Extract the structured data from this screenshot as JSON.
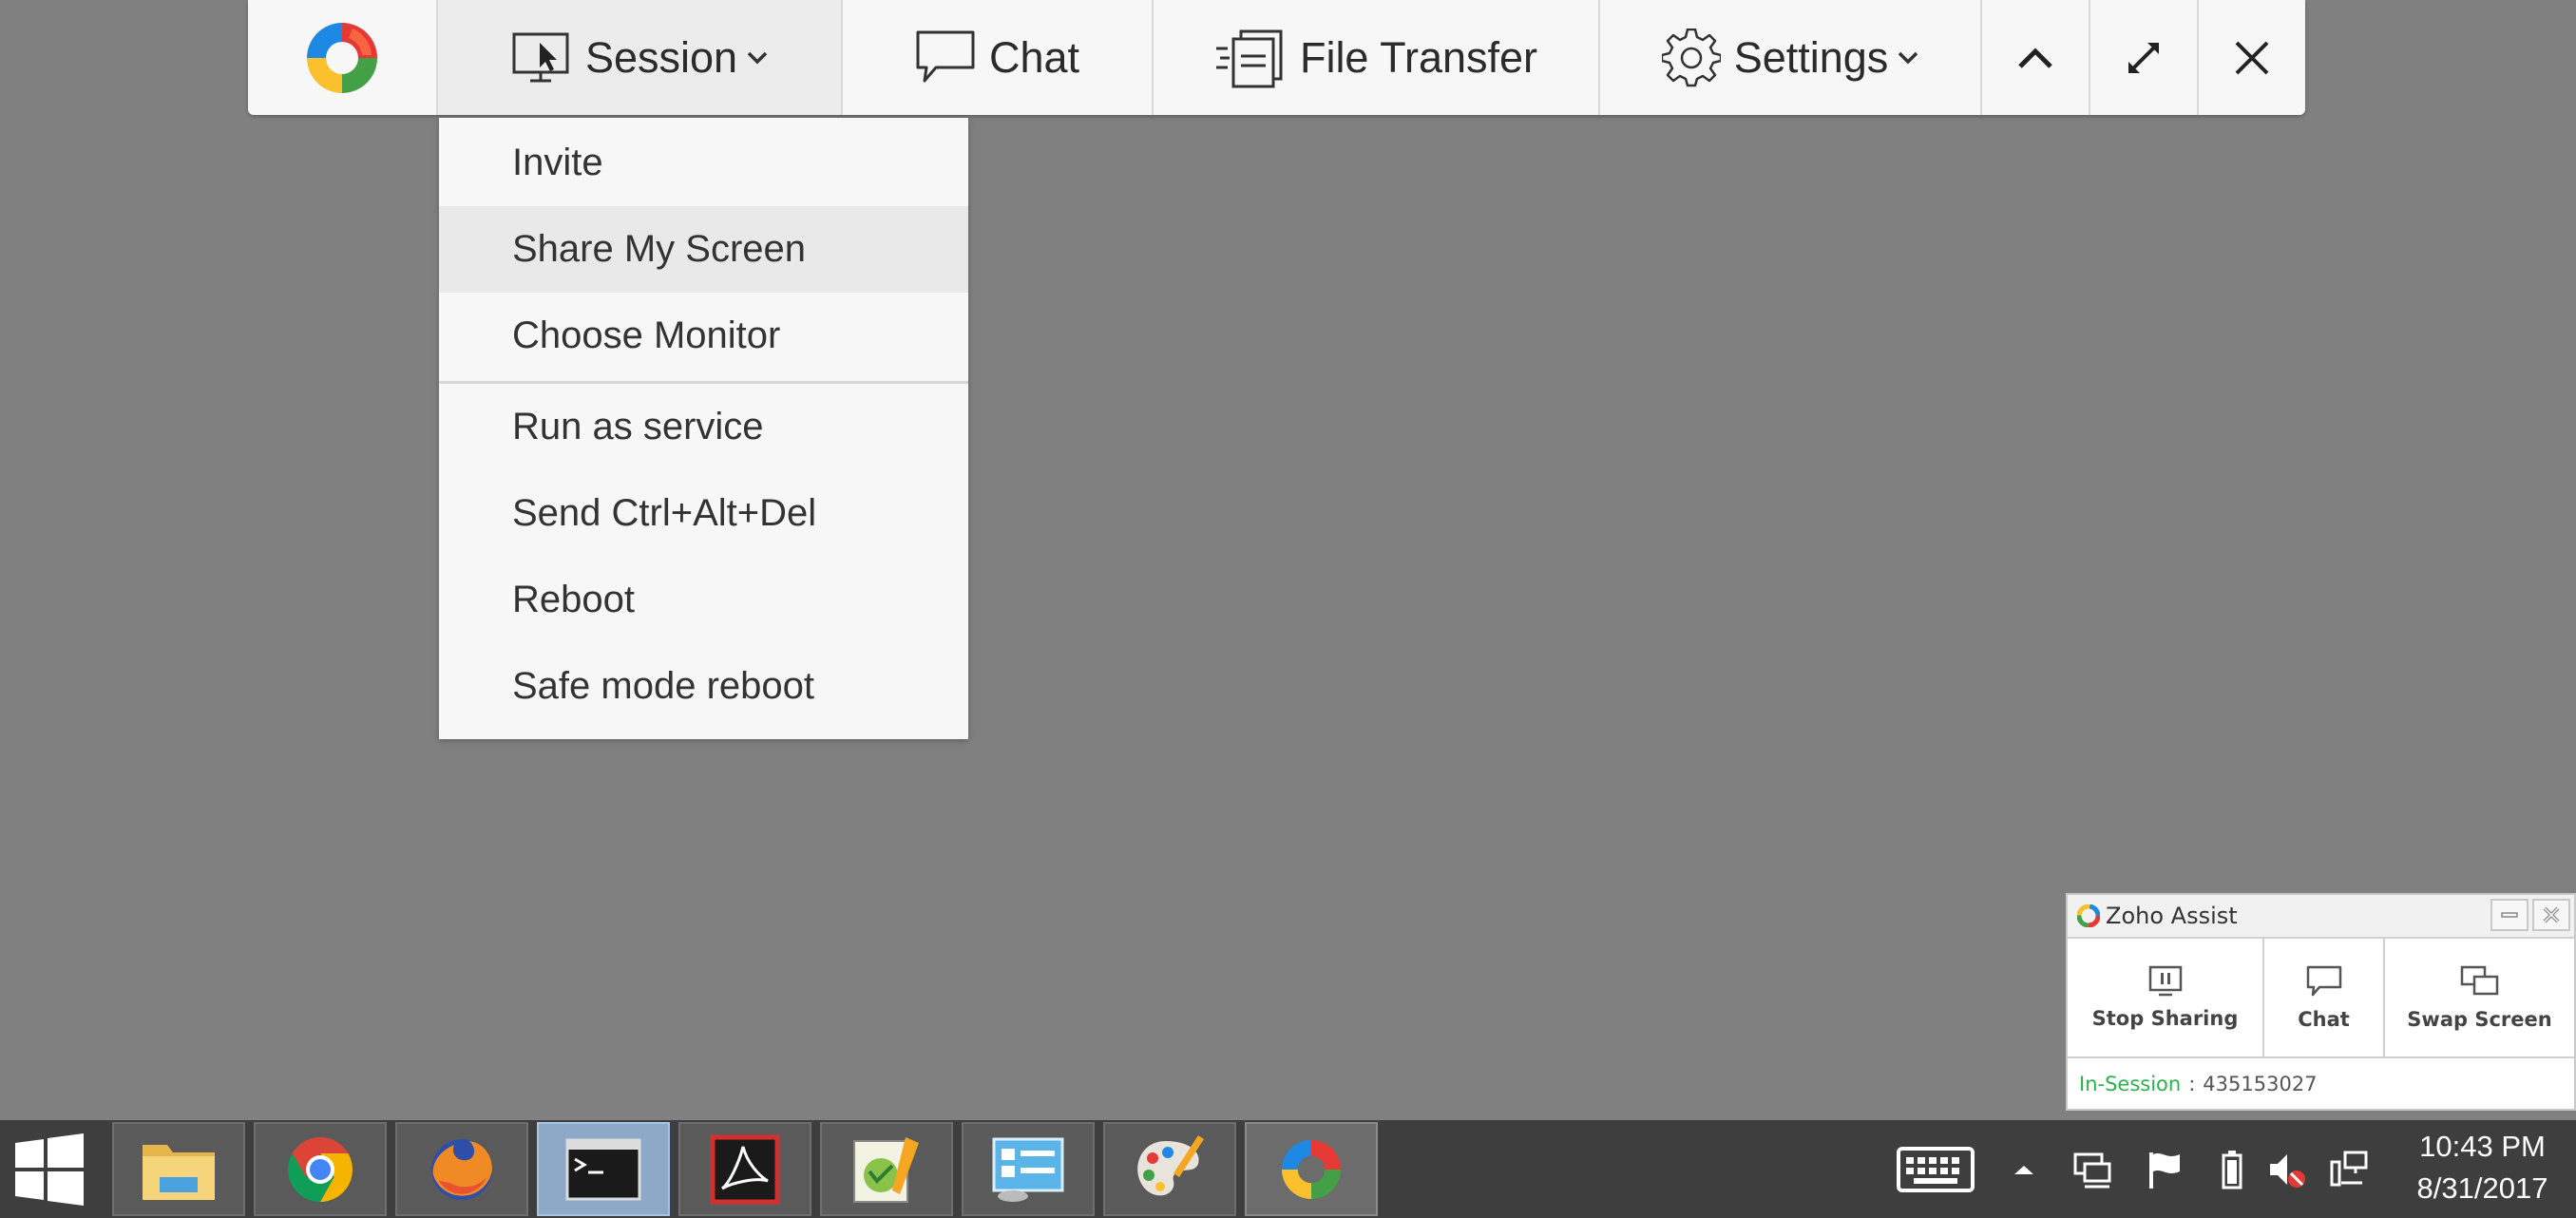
{
  "toolbar": {
    "logo": "zoho-assist-logo",
    "session_label": "Session",
    "chat_label": "Chat",
    "file_transfer_label": "File Transfer",
    "settings_label": "Settings",
    "collapse_icon": "chevron-up-icon",
    "fullscreen_icon": "expand-icon",
    "close_icon": "close-icon"
  },
  "session_menu": {
    "items": [
      "Invite",
      "Share My Screen",
      "Choose Monitor",
      "Run as service",
      "Send Ctrl+Alt+Del",
      "Reboot",
      "Safe mode reboot"
    ],
    "highlighted": "Share My Screen"
  },
  "assist_panel": {
    "title": "Zoho Assist",
    "stop_sharing_label": "Stop Sharing",
    "chat_label": "Chat",
    "swap_screen_label": "Swap Screen",
    "status_label": "In-Session",
    "status_separator": ":",
    "session_id": "435153027",
    "status_color": "#2bb24c"
  },
  "taskbar": {
    "apps": [
      "file-explorer-icon",
      "chrome-icon",
      "firefox-icon",
      "command-prompt-icon",
      "acrobat-icon",
      "notepad-plus-plus-icon",
      "control-panel-icon",
      "paint-icon",
      "zoho-assist-icon"
    ],
    "active_app": "command-prompt-icon",
    "tray": [
      "keyboard-icon",
      "chevron-up-icon",
      "network-share-icon",
      "flag-icon",
      "battery-icon",
      "volume-muted-icon",
      "network-icon"
    ],
    "time": "10:43 PM",
    "date": "8/31/2017"
  },
  "colors": {
    "desktop": "#808080",
    "toolbar": "#f7f7f7",
    "taskbar": "#3e3e3e",
    "accent_green": "#2bb24c"
  }
}
